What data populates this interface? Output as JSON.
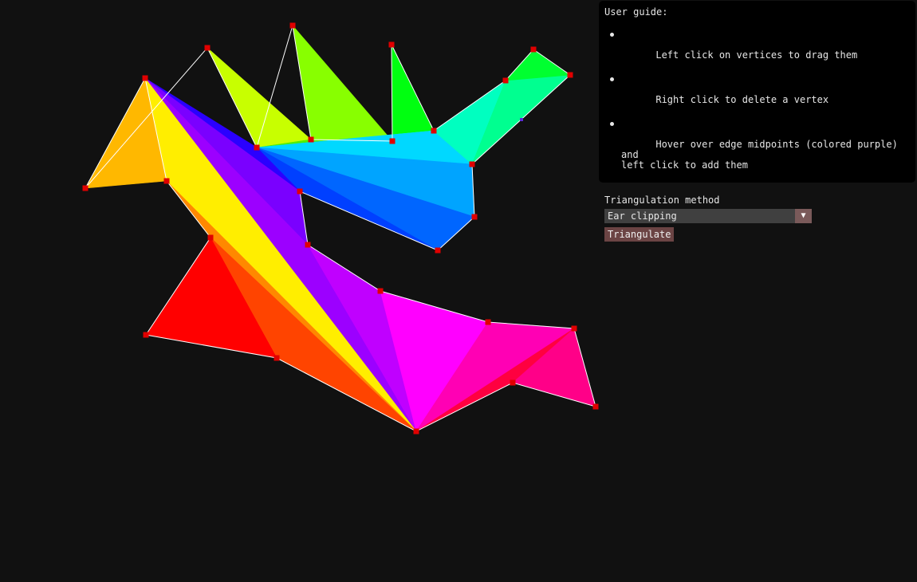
{
  "guide": {
    "title": "User guide:",
    "items": [
      "Left click on vertices to drag them",
      "Right click to delete a vertex",
      "Hover over edge midpoints (colored purple) and\nleft click to add them"
    ],
    "method_label": "Triangulation method",
    "method_value": "Ear clipping",
    "triangulate_label": "Triangulate"
  },
  "colors": {
    "background": "#111111",
    "panel": "#000000",
    "vertex": "#e00000",
    "edge": "#ffffff",
    "midpoint": "#5a2bd8",
    "select_bg": "#404040",
    "select_arrow": "#7a5a5a",
    "button": "#6b4444"
  },
  "icons": {
    "dropdown": "triangle-down-icon",
    "bullet": "bullet-dot-icon"
  }
}
